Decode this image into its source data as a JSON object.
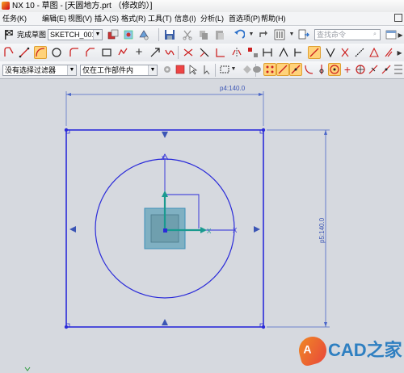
{
  "window": {
    "title": "NX 10 - 草图 - [天圆地方.prt （修改的）]"
  },
  "menu": {
    "items": [
      "任务(K)",
      "编辑(E)",
      "视图(V)",
      "插入(S)",
      "格式(R)",
      "工具(T)",
      "信息(I)",
      "分析(L)",
      "首选项(P)",
      "帮助(H)"
    ]
  },
  "toolbar": {
    "finish_sketch_label": "完成草图",
    "sketch_name": "SKETCH_001",
    "command_search_placeholder": "查找命令"
  },
  "selection": {
    "filter": "没有选择过滤器",
    "scope": "仅在工作部件内"
  },
  "sketch": {
    "horizontal_dimension": "p4:140.0",
    "vertical_dimension": "p5:140.0",
    "axis_x": "X",
    "axis_y": "Y"
  },
  "colors": {
    "sketch_blue": "#2b2bd9",
    "dimension_blue": "#4a66c8",
    "csys_teal": "#1a9a8f",
    "csys_fill": "#7fb0c2"
  },
  "watermark": {
    "badge": "A",
    "brand": "CAD之家"
  }
}
